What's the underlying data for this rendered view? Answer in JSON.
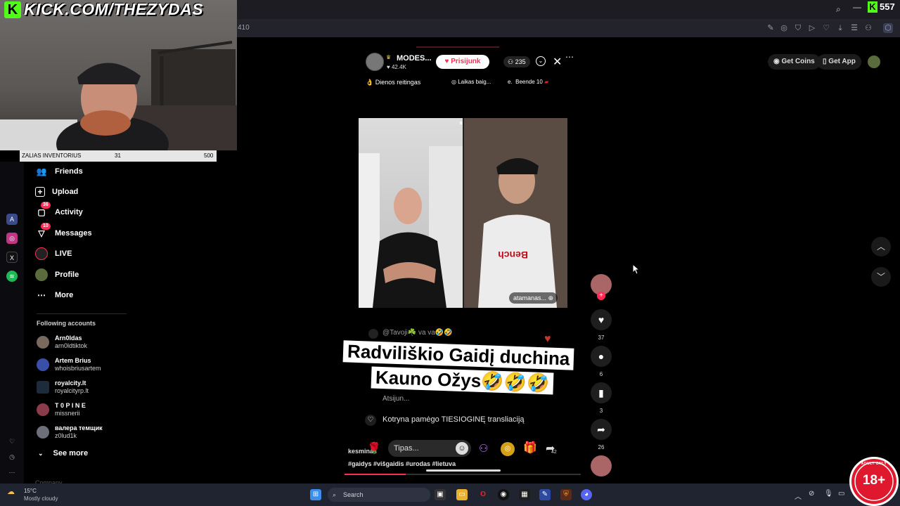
{
  "overlay": {
    "kick_banner": "KICK.COM/THEZYDAS",
    "kick_logo_letter": "K",
    "viewer_count": "557",
    "inventory": {
      "label": "ZALIAS INVENTORIUS",
      "current": "31",
      "max": "500"
    }
  },
  "browser": {
    "url_fragment": "410"
  },
  "sidebar": {
    "items": [
      {
        "label": "Friends",
        "icon": "friends-icon",
        "badge": ""
      },
      {
        "label": "Upload",
        "icon": "upload-icon",
        "badge": ""
      },
      {
        "label": "Activity",
        "icon": "activity-icon",
        "badge": "36"
      },
      {
        "label": "Messages",
        "icon": "messages-icon",
        "badge": "10"
      },
      {
        "label": "LIVE",
        "icon": "live-icon",
        "badge": ""
      },
      {
        "label": "Profile",
        "icon": "profile-icon",
        "badge": ""
      },
      {
        "label": "More",
        "icon": "more-icon",
        "badge": ""
      }
    ],
    "following_title": "Following accounts",
    "accounts": [
      {
        "name": "Arn0ldas",
        "handle": "arn0ldtiktok"
      },
      {
        "name": "Artem Brius",
        "handle": "whoisbriusartem"
      },
      {
        "name": "royalcity.lt",
        "handle": "royalcityrp.lt"
      },
      {
        "name": "T 0 P I N E",
        "handle": "missnerii"
      },
      {
        "name": "валера темщик",
        "handle": "z0lud1k"
      }
    ],
    "see_more": "See more",
    "company": "Company"
  },
  "live": {
    "host_name": "MODES...",
    "likes": "42.4K",
    "join_label": "Prisijunk",
    "viewers": "235",
    "chips": [
      "Dienos reitingas",
      "Laikas baig...",
      "Beende 10"
    ],
    "chip_prefix": "e.",
    "guest_name": "atamanas...",
    "comment": "@Tavoji☘️ va va🤣🤣",
    "caption_line1": "Radviliškio Gaidį duchina",
    "caption_line2": "Kauno Ožys🤣🤣🤣",
    "join_notice_partial": "Atsijun...",
    "watched_notice": "Kotryna pamėgo TIESIOGINĘ transliaciją",
    "chat_placeholder": "Tipas...",
    "chat_user": "kesminas",
    "share_count": "42",
    "hashtags": "#gaidys #višgaidis #urodas #lietuva"
  },
  "actions": {
    "likes": "37",
    "comments": "6",
    "saves": "3",
    "shares": "26"
  },
  "topright": {
    "get_coins": "Get Coins",
    "get_app": "Get App"
  },
  "taskbar": {
    "weather_temp": "15°C",
    "weather_desc": "Mostly cloudy",
    "search": "Search"
  },
  "adult_badge": {
    "text": "18+",
    "ring_text": "ADULT ONLY"
  }
}
